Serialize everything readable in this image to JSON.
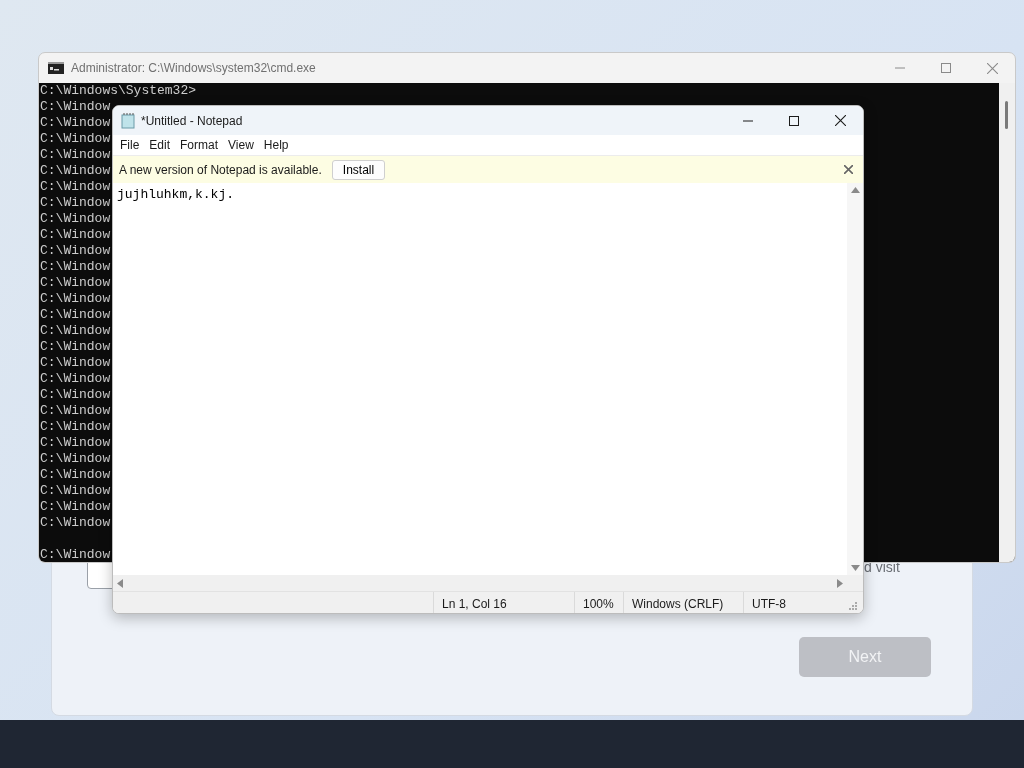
{
  "setup_card": {
    "partial_text": "d visit",
    "next_button": {
      "label": "Next",
      "disabled": true
    }
  },
  "cmd_window": {
    "title": "Administrator: C:\\Windows\\system32\\cmd.exe",
    "lines": [
      "C:\\Windows\\System32>",
      "C:\\Window",
      "C:\\Window",
      "C:\\Window",
      "C:\\Window",
      "C:\\Window",
      "C:\\Window",
      "C:\\Window",
      "C:\\Window",
      "C:\\Window",
      "C:\\Window",
      "C:\\Window",
      "C:\\Window",
      "C:\\Window",
      "C:\\Window",
      "C:\\Window",
      "C:\\Window",
      "C:\\Window",
      "C:\\Window",
      "C:\\Window",
      "C:\\Window",
      "C:\\Window",
      "C:\\Window",
      "C:\\Window",
      "C:\\Window",
      "C:\\Window",
      "C:\\Window",
      "C:\\Window",
      {
        "kind": "blank"
      },
      "C:\\Window"
    ]
  },
  "notepad": {
    "title": "*Untitled - Notepad",
    "menu": [
      "File",
      "Edit",
      "Format",
      "View",
      "Help"
    ],
    "info_bar": {
      "message": "A new version of Notepad is available.",
      "button": "Install"
    },
    "text": "jujhluhkm,k.kj.",
    "status_bar": [
      "Ln 1, Col 16",
      "100%",
      "Windows (CRLF)",
      "UTF-8"
    ]
  }
}
